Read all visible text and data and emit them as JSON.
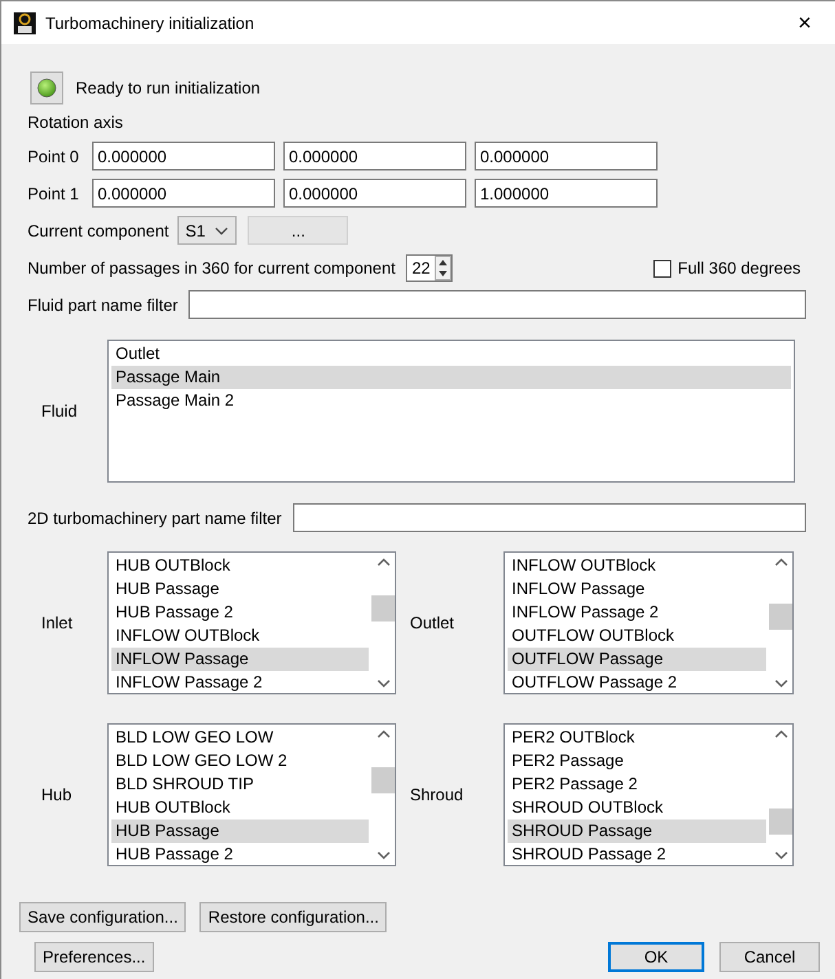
{
  "window": {
    "title": "Turbomachinery initialization",
    "close": "×"
  },
  "status": {
    "ready": true,
    "label": "Ready to run initialization"
  },
  "rotation_axis": {
    "label": "Rotation axis",
    "points": [
      {
        "label": "Point 0",
        "values": [
          "0.000000",
          "0.000000",
          "0.000000"
        ]
      },
      {
        "label": "Point 1",
        "values": [
          "0.000000",
          "0.000000",
          "1.000000"
        ]
      }
    ]
  },
  "current_component": {
    "label": "Current component",
    "value": "S1",
    "button": "..."
  },
  "passages": {
    "label": "Number of passages in 360 for current component",
    "value": "22"
  },
  "full_360": {
    "label": "Full 360 degrees",
    "checked": false
  },
  "fluid_filter": {
    "label": "Fluid part name filter"
  },
  "fluid": {
    "label": "Fluid",
    "items": [
      {
        "label": "Outlet",
        "selected": false
      },
      {
        "label": "Passage Main",
        "selected": true
      },
      {
        "label": "Passage Main 2",
        "selected": false
      }
    ]
  },
  "filter_2d": {
    "label": "2D turbomachinery part name filter"
  },
  "part_lists": [
    {
      "label": "Inlet",
      "items": [
        {
          "label": "HUB OUTBlock",
          "selected": false
        },
        {
          "label": "HUB Passage",
          "selected": false
        },
        {
          "label": "HUB Passage 2",
          "selected": false
        },
        {
          "label": "INFLOW OUTBlock",
          "selected": false
        },
        {
          "label": "INFLOW Passage",
          "selected": true
        },
        {
          "label": "INFLOW Passage 2",
          "selected": false
        }
      ]
    },
    {
      "label": "Outlet",
      "items": [
        {
          "label": "INFLOW OUTBlock",
          "selected": false
        },
        {
          "label": "INFLOW Passage",
          "selected": false
        },
        {
          "label": "INFLOW Passage 2",
          "selected": false
        },
        {
          "label": "OUTFLOW OUTBlock",
          "selected": false
        },
        {
          "label": "OUTFLOW Passage",
          "selected": true
        },
        {
          "label": "OUTFLOW Passage 2",
          "selected": false
        }
      ]
    },
    {
      "label": "Hub",
      "items": [
        {
          "label": "BLD LOW GEO LOW",
          "selected": false
        },
        {
          "label": "BLD LOW GEO LOW 2",
          "selected": false
        },
        {
          "label": "BLD SHROUD TIP",
          "selected": false
        },
        {
          "label": "HUB OUTBlock",
          "selected": false
        },
        {
          "label": "HUB Passage",
          "selected": true
        },
        {
          "label": "HUB Passage 2",
          "selected": false
        }
      ]
    },
    {
      "label": "Shroud",
      "items": [
        {
          "label": "PER2 OUTBlock",
          "selected": false
        },
        {
          "label": "PER2 Passage",
          "selected": false
        },
        {
          "label": "PER2 Passage 2",
          "selected": false
        },
        {
          "label": "SHROUD OUTBlock",
          "selected": false
        },
        {
          "label": "SHROUD Passage",
          "selected": true
        },
        {
          "label": "SHROUD Passage 2",
          "selected": false
        }
      ]
    }
  ],
  "config_buttons": [
    {
      "label": "Save configuration...",
      "default": false
    },
    {
      "label": "Restore configuration...",
      "default": false
    }
  ],
  "preferences_button": {
    "label": "Preferences...",
    "default": false
  },
  "dialog_buttons": [
    {
      "label": "OK",
      "default": true
    },
    {
      "label": "Cancel",
      "default": false
    }
  ]
}
